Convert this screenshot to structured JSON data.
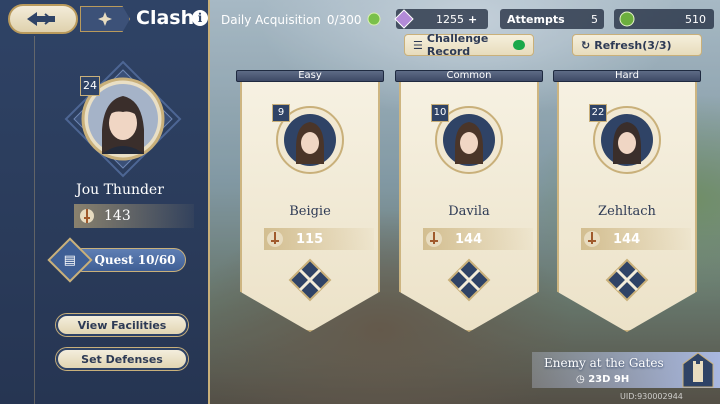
{
  "header": {
    "title": "Clash"
  },
  "player": {
    "level": "24",
    "name": "Jou Thunder",
    "power": "143"
  },
  "quest": {
    "label": "Quest 10/60"
  },
  "sidebar_buttons": {
    "view_facilities": "View Facilities",
    "set_defenses": "Set Defenses"
  },
  "topbar": {
    "daily_label": "Daily Acquisition",
    "daily_count": "0/300",
    "gem_value": "1255",
    "attempts_label": "Attempts",
    "attempts_value": "5",
    "coin_value": "510",
    "challenge_record": "Challenge Record",
    "refresh": "Refresh(3/3)"
  },
  "opponents": [
    {
      "difficulty": "Easy",
      "level": "9",
      "name": "Beigie",
      "power": "115"
    },
    {
      "difficulty": "Common",
      "level": "10",
      "name": "Davila",
      "power": "144"
    },
    {
      "difficulty": "Hard",
      "level": "22",
      "name": "Zehltach",
      "power": "144"
    }
  ],
  "event": {
    "title": "Enemy at the Gates",
    "duration": "23D 9H"
  },
  "uid": "UID:930002944",
  "colors": {
    "panel": "#2f4366",
    "gold": "#c9b07a",
    "card": "#f6f1e2",
    "toggle": "#1aa84a"
  }
}
